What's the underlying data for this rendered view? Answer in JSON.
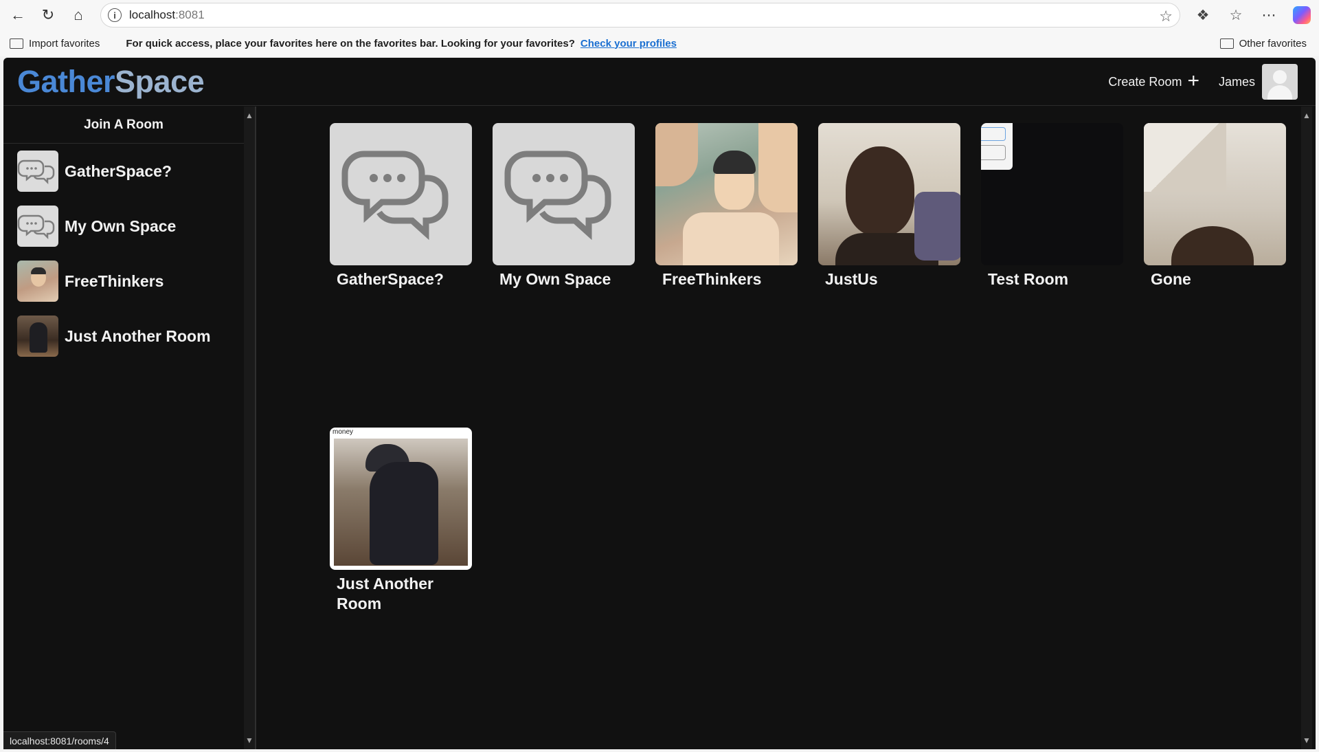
{
  "browser": {
    "url_host": "localhost",
    "url_port": ":8081",
    "favorites_bar": {
      "import_label": "Import favorites",
      "message": "For quick access, place your favorites here on the favorites bar. Looking for your favorites?",
      "link": "Check your profiles",
      "other_label": "Other favorites"
    },
    "status_url": "localhost:8081/rooms/4"
  },
  "app": {
    "logo_part1": "Gather",
    "logo_part2": "Space",
    "header": {
      "create_room_label": "Create Room",
      "user_name": "James"
    },
    "sidebar": {
      "title": "Join A Room",
      "items": [
        {
          "label": "GatherSpace?",
          "thumb": "chat-placeholder"
        },
        {
          "label": "My Own Space",
          "thumb": "chat-placeholder"
        },
        {
          "label": "FreeThinkers",
          "thumb": "photo"
        },
        {
          "label": "Just Another Room",
          "thumb": "photo"
        }
      ]
    },
    "rooms": [
      {
        "label": "GatherSpace?",
        "thumb": "chat-placeholder"
      },
      {
        "label": "My Own Space",
        "thumb": "chat-placeholder"
      },
      {
        "label": "FreeThinkers",
        "thumb": "photo"
      },
      {
        "label": "JustUs",
        "thumb": "photo"
      },
      {
        "label": "Test Room",
        "thumb": "photo"
      },
      {
        "label": "Gone",
        "thumb": "photo"
      },
      {
        "label": "Just Another Room",
        "thumb": "photo",
        "caption": "money"
      }
    ]
  },
  "colors": {
    "background": "#111111",
    "logo_primary": "#4a88d6",
    "logo_secondary": "#9bb3cf",
    "placeholder": "#d8d8d8",
    "chat_icon": "#7d7d7d"
  }
}
